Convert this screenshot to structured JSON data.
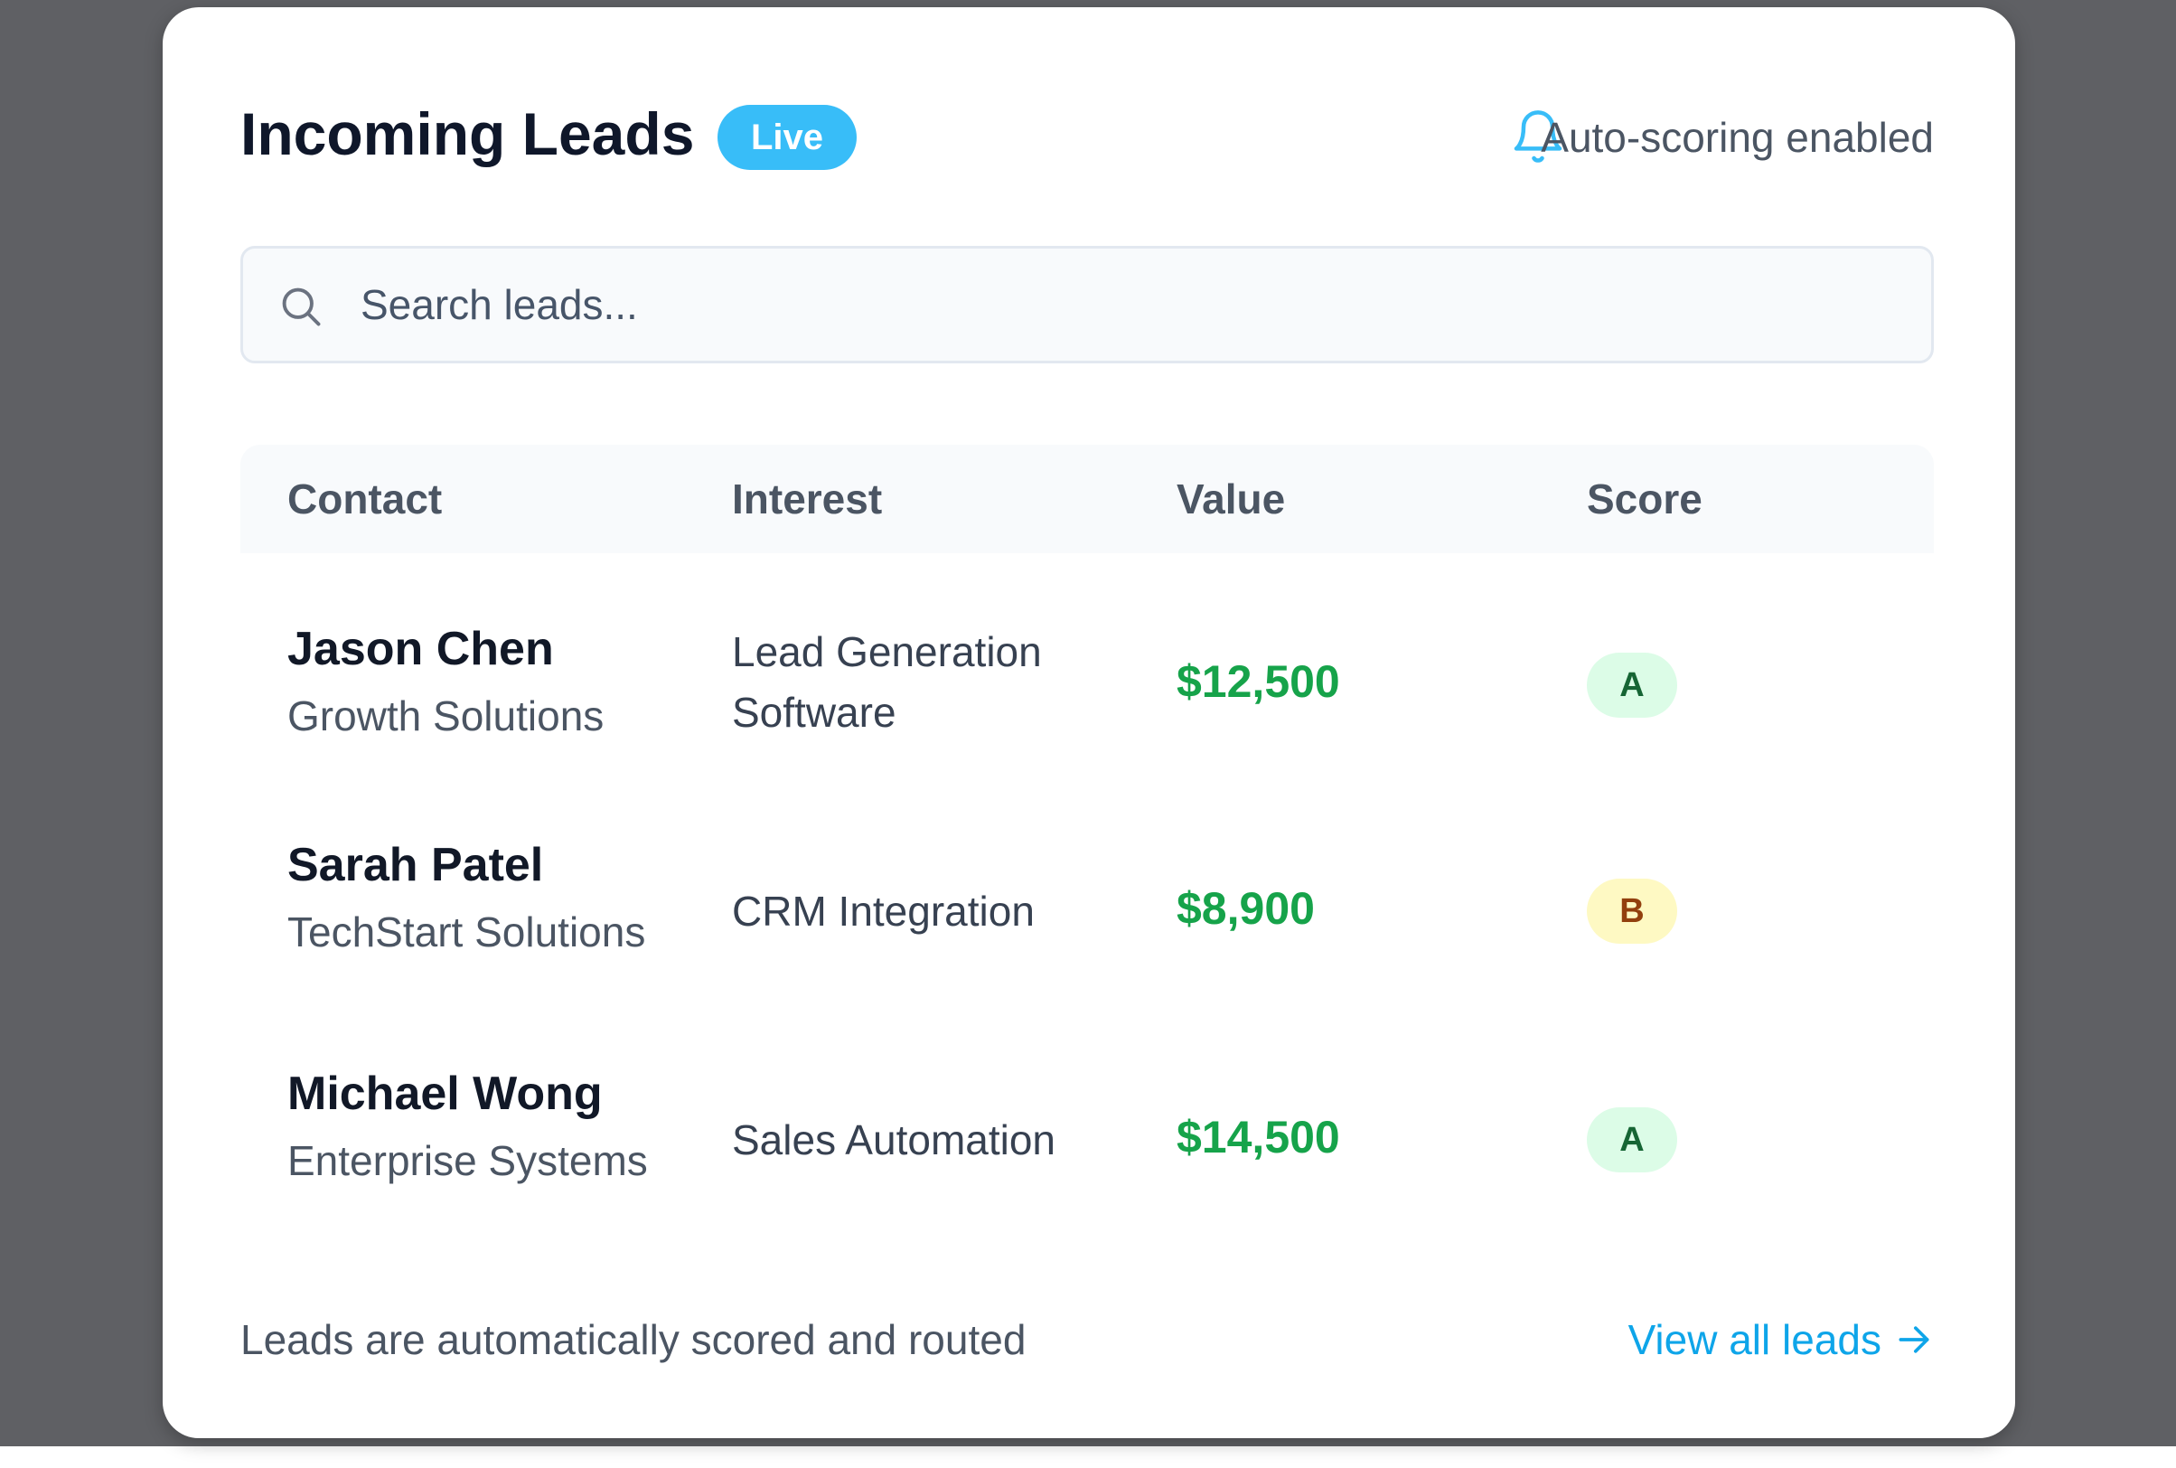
{
  "header": {
    "title": "Incoming Leads",
    "badge": "Live",
    "bell_icon": "bell-icon",
    "auto_scoring_label": "Auto-scoring enabled"
  },
  "search": {
    "icon": "search-icon",
    "placeholder": "Search leads...",
    "value": ""
  },
  "table": {
    "columns": [
      "Contact",
      "Interest",
      "Value",
      "Score"
    ],
    "rows": [
      {
        "name": "Jason Chen",
        "company": "Growth Solutions",
        "interest": "Lead Generation Software",
        "value": "$12,500",
        "score": "A"
      },
      {
        "name": "Sarah Patel",
        "company": "TechStart Solutions",
        "interest": "CRM Integration",
        "value": "$8,900",
        "score": "B"
      },
      {
        "name": "Michael Wong",
        "company": "Enterprise Systems",
        "interest": "Sales Automation",
        "value": "$14,500",
        "score": "A"
      }
    ]
  },
  "footer": {
    "note": "Leads are automatically scored and routed",
    "link_label": "View all leads",
    "link_icon": "arrow-right-icon"
  },
  "colors": {
    "accent": "#38bdf8",
    "link": "#0ea5e9",
    "value_green": "#16a34a",
    "grade_a_bg": "#dcfce7",
    "grade_b_bg": "#fef9c3"
  }
}
